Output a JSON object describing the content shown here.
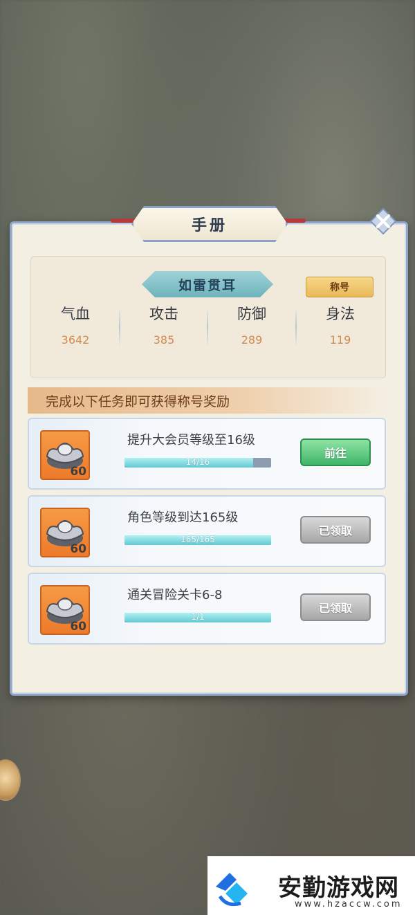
{
  "window": {
    "title": "手册"
  },
  "honor": {
    "name": "如雷贯耳",
    "tag": "称号"
  },
  "stats": [
    {
      "label": "气血",
      "value": "3642"
    },
    {
      "label": "攻击",
      "value": "385"
    },
    {
      "label": "防御",
      "value": "289"
    },
    {
      "label": "身法",
      "value": "119"
    }
  ],
  "banner": {
    "text": "完成以下任务即可获得称号奖励"
  },
  "tasks": [
    {
      "name": "提升大会员等级至16级",
      "progress_text": "14/16",
      "progress": 0.875,
      "reward_count": "60",
      "button": "前往",
      "button_state": "go"
    },
    {
      "name": "角色等级到达165级",
      "progress_text": "165/165",
      "progress": 1.0,
      "reward_count": "60",
      "button": "已领取",
      "button_state": "claimed"
    },
    {
      "name": "通关冒险关卡6-8",
      "progress_text": "1/1",
      "progress": 1.0,
      "reward_count": "60",
      "button": "已领取",
      "button_state": "claimed"
    }
  ],
  "watermark": {
    "title": "安勤游戏网",
    "url": "www.hzaccw.com"
  },
  "colors": {
    "accent_frame": "#8fa5c9",
    "stat_value": "#d18a50",
    "go_button": "#3fb66a",
    "claimed_button": "#a7a7a7",
    "reward_bg": "#ee7a2a"
  }
}
